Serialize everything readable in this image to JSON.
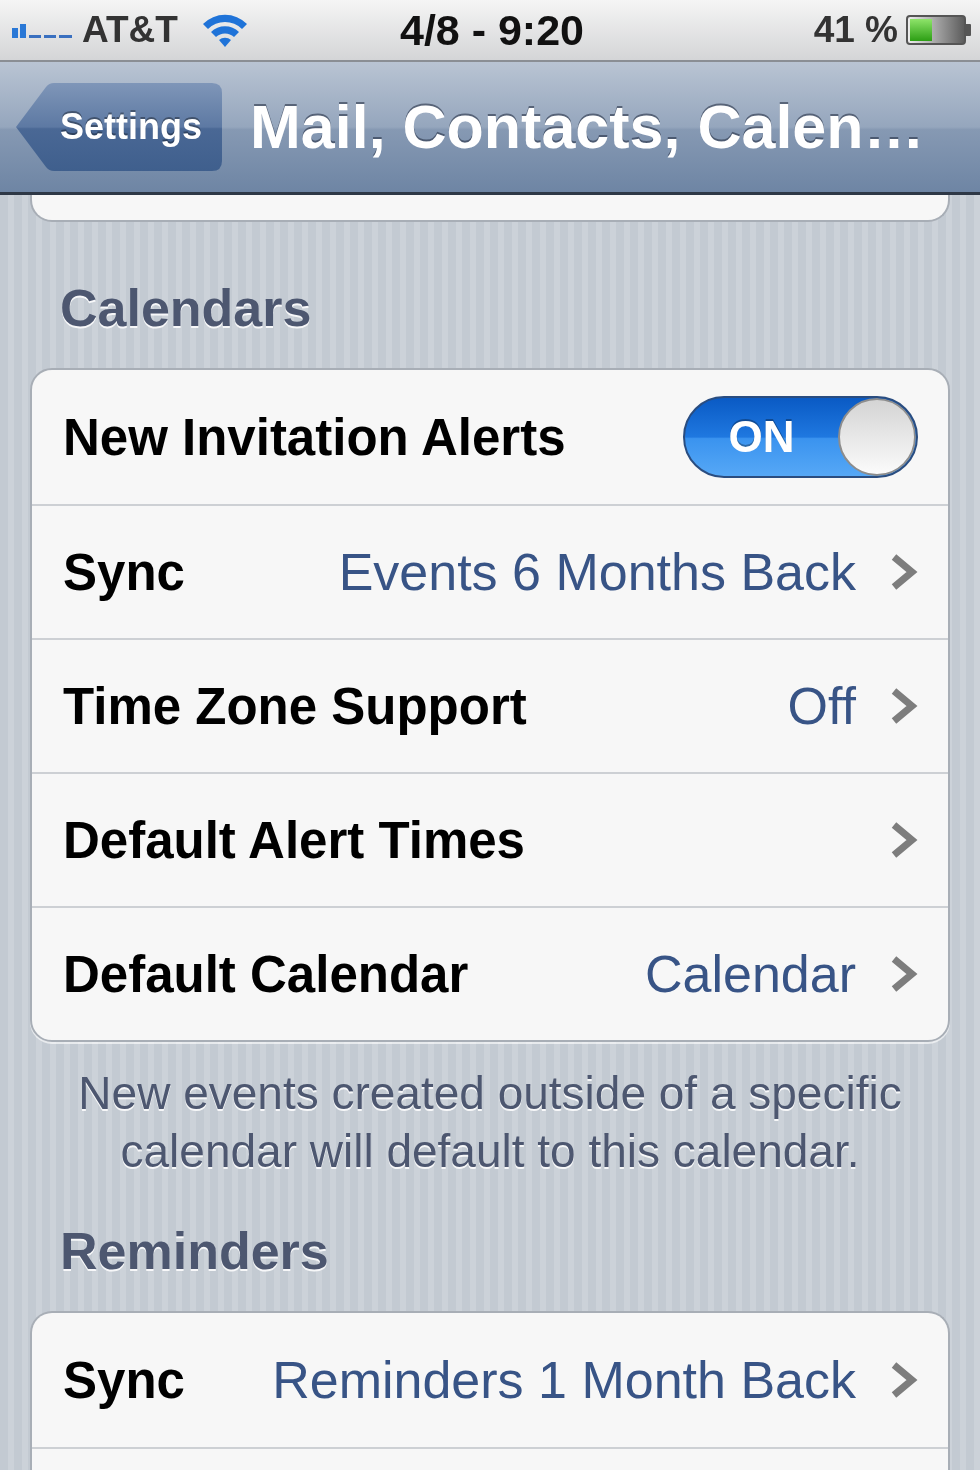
{
  "status_bar": {
    "carrier": "AT&T",
    "time": "4/8 - 9:20",
    "battery": "41 %"
  },
  "nav_bar": {
    "back_button": "Settings",
    "title": "Mail, Contacts, Calen…"
  },
  "sections": [
    {
      "kind": "partial_top"
    },
    {
      "kind": "group",
      "header": "Calendars",
      "continues_below": false,
      "rows": [
        {
          "kind": "toggle",
          "label": "New Invitation Alerts",
          "on": true,
          "switch_text": "ON"
        },
        {
          "kind": "disclosure",
          "label": "Sync",
          "value": "Events 6 Months Back"
        },
        {
          "kind": "disclosure",
          "label": "Time Zone Support",
          "value": "Off"
        },
        {
          "kind": "disclosure",
          "label": "Default Alert Times"
        },
        {
          "kind": "disclosure",
          "label": "Default Calendar",
          "value": "Calendar"
        }
      ],
      "footer": "New events created outside of a specific calendar will default to this calendar."
    },
    {
      "kind": "group",
      "header": "Reminders",
      "continues_below": true,
      "rows": [
        {
          "kind": "disclosure",
          "label": "Sync",
          "value": "Reminders 1 Month Back"
        }
      ]
    }
  ]
}
